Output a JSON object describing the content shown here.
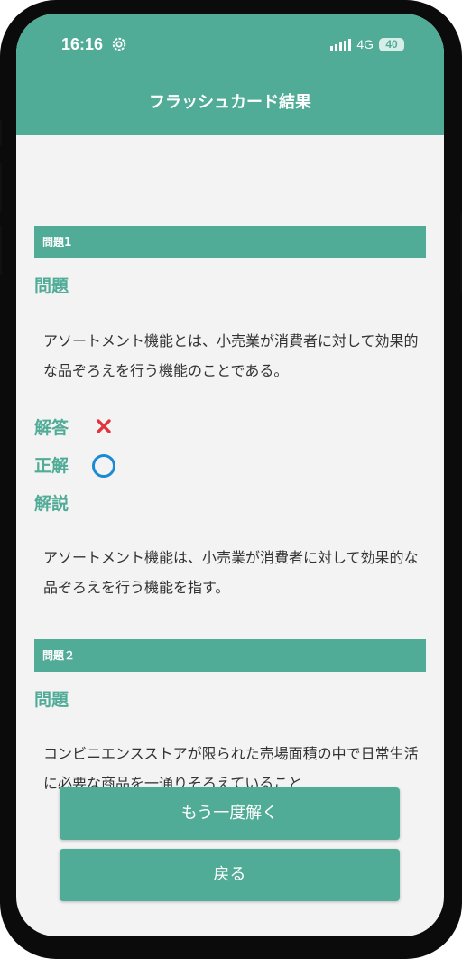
{
  "status_bar": {
    "time": "16:16",
    "network": "4G",
    "battery": "40"
  },
  "header": {
    "title": "フラッシュカード結果"
  },
  "questions": [
    {
      "number_label": "問題1",
      "question_heading": "問題",
      "question_text": "アソートメント機能とは、小売業が消費者に対して効果的な品ぞろえを行う機能のことである。",
      "answer_label": "解答",
      "answer_mark": "×",
      "correct_label": "正解",
      "correct_mark": "○",
      "explanation_label": "解説",
      "explanation_text": "アソートメント機能は、小売業が消費者に対して効果的な品ぞろえを行う機能を指す。"
    },
    {
      "number_label": "問題２",
      "question_heading": "問題",
      "question_text": "コンビニエンスストアが限られた売場面積の中で日常生活に必要な商品を一通りそろえていること"
    }
  ],
  "buttons": {
    "retry": "もう一度解く",
    "back": "戻る"
  },
  "colors": {
    "accent": "#50ab97",
    "wrong": "#e0353d",
    "correct": "#1a8ad4"
  }
}
